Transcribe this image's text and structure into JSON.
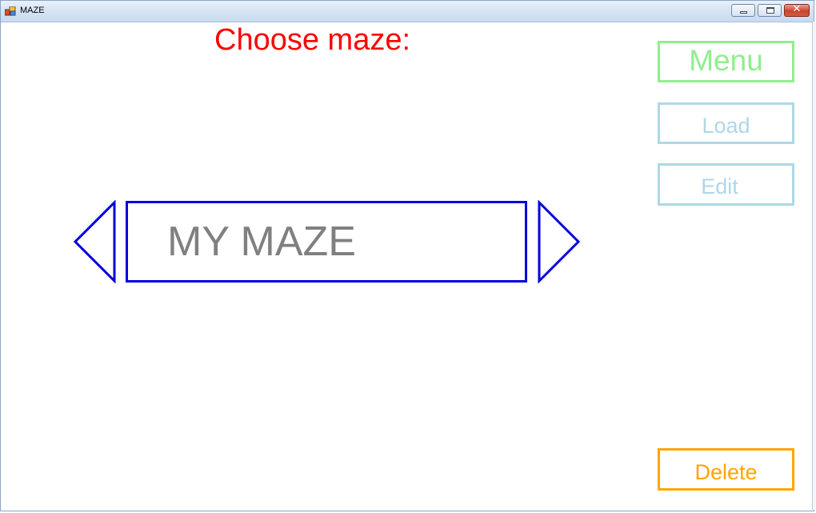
{
  "window": {
    "title": "MAZE",
    "close_glyph": "✕",
    "icons": {
      "app": "app-icon",
      "minimize": "minimize-icon",
      "maximize": "maximize-icon",
      "close": "close-icon"
    }
  },
  "main": {
    "heading": "Choose maze:",
    "heading_color": "#ff0000",
    "selected_maze": "MY MAZE",
    "prev_icon": "triangle-left-icon",
    "next_icon": "triangle-right-icon",
    "selector_color": "#0000dd"
  },
  "sidebar": {
    "menu_label": "Menu",
    "load_label": "Load",
    "edit_label": "Edit",
    "delete_label": "Delete",
    "colors": {
      "menu": "#90ee90",
      "load": "#add8e6",
      "edit": "#add8e6",
      "delete": "#ffa500"
    }
  }
}
